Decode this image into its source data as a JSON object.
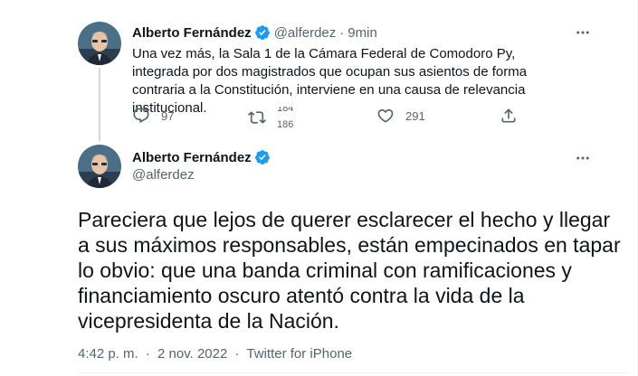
{
  "first_tweet": {
    "author_name": "Alberto Fernández",
    "handle": "@alferdez",
    "separator": "·",
    "time": "9min",
    "text": "Una vez más, la Sala 1 de la Cámara Federal de Comodoro Py, integrada por dos magistrados que ocupan sus asientos de forma contraria a la Constitución, interviene en una causa de relevancia institucional.",
    "replies": "97",
    "retweets_old": "184",
    "retweets_new": "186",
    "likes": "291",
    "icons": [
      "reply-icon",
      "retweet-icon",
      "like-icon",
      "share-icon",
      "more-icon",
      "verified-badge-icon"
    ]
  },
  "main_tweet": {
    "author_name": "Alberto Fernández",
    "handle": "@alferdez",
    "text": "Pareciera que lejos de querer esclarecer el hecho y llegar a sus máximos responsables, están empecinados en tapar lo obvio: que una banda criminal con ramificaciones y financiamiento oscuro atentó contra la vida de la vicepresidenta de la Nación.",
    "time": "4:42 p. m.",
    "date": "2 nov. 2022",
    "source": "Twitter for iPhone",
    "separator": "·"
  },
  "colors": {
    "verified": "#1d9bf0",
    "secondary_text": "#536471",
    "primary_text": "#0f1419",
    "thread_line": "#cfd9de"
  }
}
